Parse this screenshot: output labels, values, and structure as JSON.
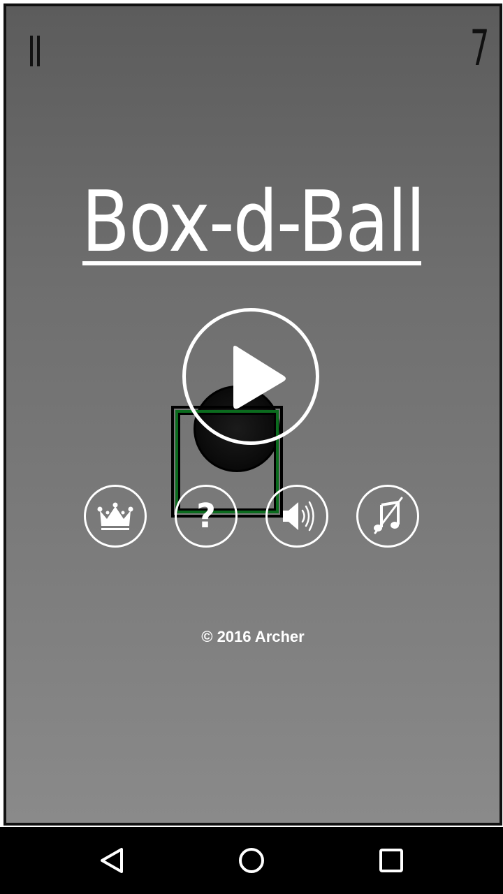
{
  "hud": {
    "pause_icon": "pause-icon",
    "score": "7"
  },
  "title": {
    "text": "Box-d-Ball",
    "color": "#ffffff"
  },
  "play": {
    "icon": "play-icon"
  },
  "menu": [
    {
      "id": "leaderboard",
      "icon": "crown-icon"
    },
    {
      "id": "help",
      "icon": "question-icon",
      "glyph": "?"
    },
    {
      "id": "sound",
      "icon": "speaker-icon"
    },
    {
      "id": "music",
      "icon": "music-muted-icon"
    }
  ],
  "footer": {
    "copyright": "© 2016 Archer"
  },
  "game_colors": {
    "box_border": "#0b6b1e",
    "ball": "#111111",
    "background_top": "#5c5c5c",
    "background_bottom": "#8a8a8a"
  },
  "nav": {
    "back_icon": "back-triangle-icon",
    "home_icon": "home-circle-icon",
    "recents_icon": "recents-square-icon"
  }
}
